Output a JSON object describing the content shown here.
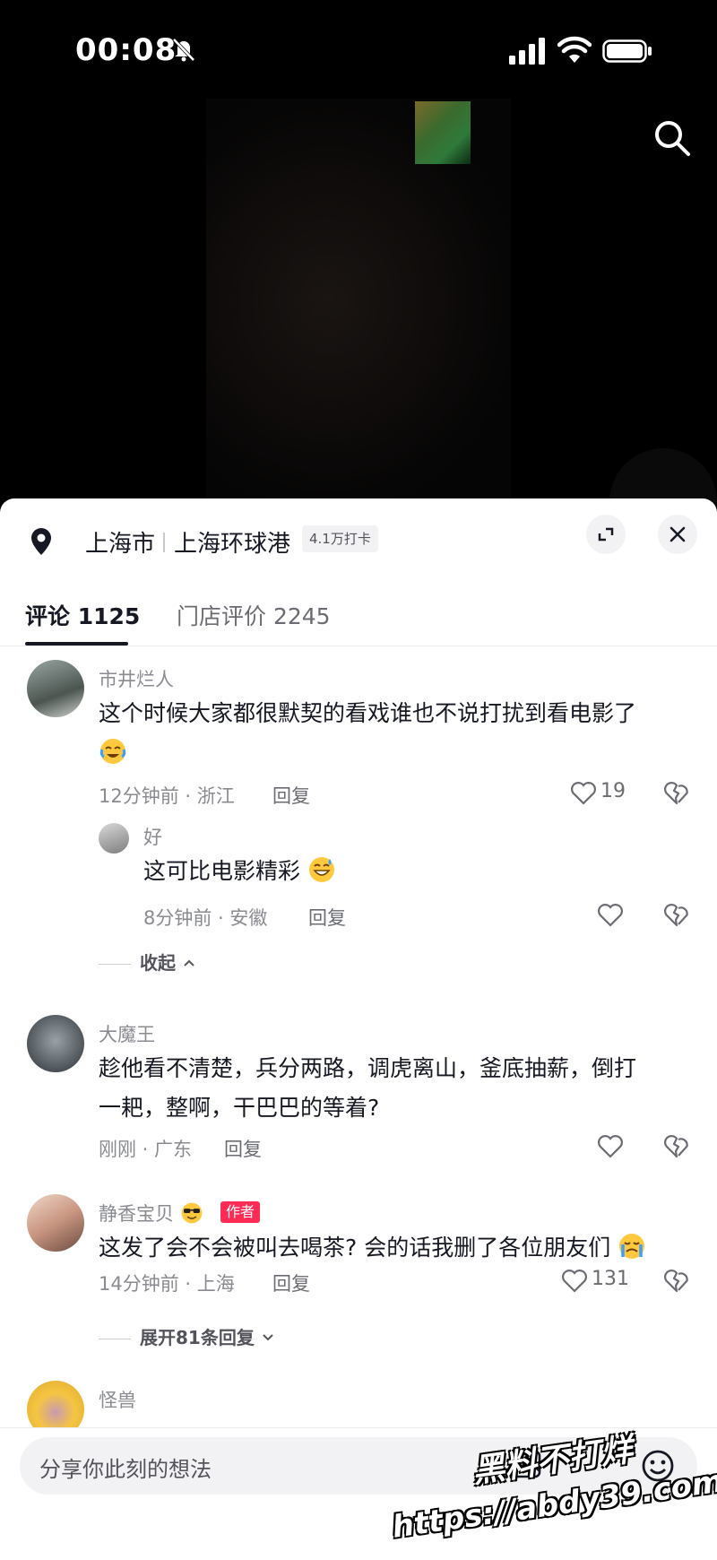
{
  "status_bar": {
    "time": "00:08"
  },
  "location": {
    "city": "上海市",
    "place": "上海环球港",
    "checkins": "4.1万打卡"
  },
  "tabs": {
    "comments_label": "评论 1125",
    "reviews_label": "门店评价 2245"
  },
  "comments": [
    {
      "username": "市井烂人",
      "text_line1": "这个时候大家都很默契的看戏谁也不说打扰到看电影了",
      "emoji": "cry-laugh-emoji",
      "meta": "12分钟前 · 浙江",
      "reply_label": "回复",
      "likes": "19",
      "replies": [
        {
          "username": "好",
          "text": "这可比电影精彩",
          "emoji": "grin-sweat-emoji",
          "meta": "8分钟前 · 安徽",
          "reply_label": "回复"
        }
      ],
      "collapse_label": "收起"
    },
    {
      "username": "大魔王",
      "text_line1": "趁他看不清楚，兵分两路，调虎离山，釜底抽薪，倒打",
      "text_line2": "一耙，整啊，干巴巴的等着?",
      "meta": "刚刚 · 广东",
      "reply_label": "回复"
    },
    {
      "username": "静香宝贝",
      "username_emoji": "sunglasses-emoji",
      "badge": "作者",
      "text_line1": "这发了会不会被叫去喝茶? 会的话我删了各位朋友们",
      "emoji": "crying-emoji",
      "meta": "14分钟前 · 上海",
      "reply_label": "回复",
      "likes": "131",
      "expand_label": "展开81条回复"
    },
    {
      "username": "怪兽"
    }
  ],
  "input": {
    "placeholder": "分享你此刻的想法"
  },
  "watermark": {
    "line1": "黑料不打烊",
    "line2": "https://abdy39.com"
  },
  "colors": {
    "accent": "#fe2c55",
    "text": "#161823",
    "muted": "#8a8b91"
  }
}
